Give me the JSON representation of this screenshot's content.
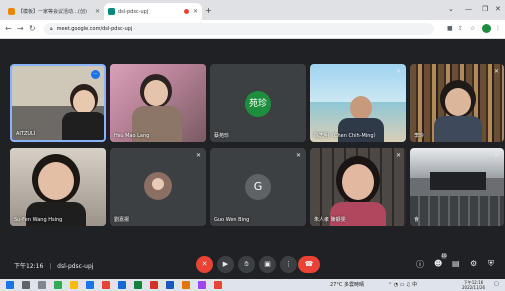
{
  "browser": {
    "tabs": [
      {
        "title": "【模板】一家等会议活动…(创)",
        "active": false
      },
      {
        "title": "dsl-pdsc-upj",
        "active": true
      }
    ],
    "url": "meet.google.com/dsl-pdsc-upj",
    "newtab": "+",
    "win_min": "⌄",
    "win_minimize": "—",
    "win_max": "❐",
    "win_close": "✕"
  },
  "meeting": {
    "code": "dsl-pdsc-upj",
    "time": "下午12:16"
  },
  "participants": [
    {
      "name": "AITZULI"
    },
    {
      "name": "Hsu Mao Lang"
    },
    {
      "name": "蔡苑珍",
      "avatar_text": "苑珍"
    },
    {
      "name": "陈志明（Chen Chih-Ming）"
    },
    {
      "name": "李玲"
    },
    {
      "name": "Su-Fen Wang Hsing"
    },
    {
      "name": "劉嘉揚"
    },
    {
      "name": "Guo Wen Bing",
      "avatar_text": "G"
    },
    {
      "name": "朱人孝 陳靜雯"
    },
    {
      "name": "會"
    }
  ],
  "taskbar": {
    "weather": "27°C 多雲時晴",
    "time": "下午12:16",
    "date": "2022/11/26"
  },
  "colors": {
    "meet_bg": "#202124",
    "tile_bg": "#3c4043",
    "danger": "#ea4335",
    "accent": "#1a73e8"
  }
}
